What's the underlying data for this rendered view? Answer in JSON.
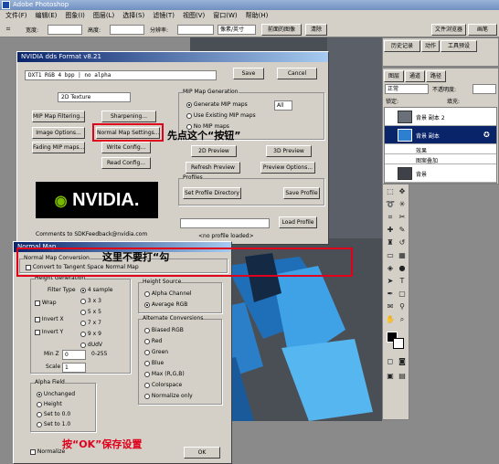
{
  "app": {
    "title": "Adobe Photoshop"
  },
  "menu": [
    "文件(F)",
    "编辑(E)",
    "图象(I)",
    "图层(L)",
    "选择(S)",
    "滤镜(T)",
    "视图(V)",
    "窗口(W)",
    "帮助(H)"
  ],
  "options": {
    "width_label": "宽度:",
    "height_label": "高度:",
    "res_label": "分辨率:",
    "unit": "像素/英寸",
    "front_btn": "前面的图像",
    "clear_btn": "清除",
    "file_browser": "文件浏览器",
    "brush": "画笔"
  },
  "dds": {
    "title": "NVIDIA dds Format v8.21",
    "format_value": "DXT1          RGB    4 bpp | no alpha",
    "save": "Save",
    "cancel": "Cancel",
    "texture_type": "2D Texture",
    "mip_filtering": "MIP Map Filtering...",
    "sharpening": "Sharpening...",
    "image_options": "Image Options...",
    "normal_map_settings": "Normal Map Settings...",
    "fading": "Fading MIP maps...",
    "write_config": "Write Config...",
    "read_config": "Read Config...",
    "mip_group": "MIP Map Generation",
    "mip_gen": "Generate MIP maps",
    "mip_all": "All",
    "mip_existing": "Use Existing MIP maps",
    "mip_none": "No MIP maps",
    "preview_2d": "2D Preview",
    "preview_3d": "3D Preview",
    "refresh": "Refresh Preview",
    "preview_options": "Preview Options...",
    "profiles": "Profiles",
    "set_profile_dir": "Set Profile Directory",
    "save_profile": "Save Profile",
    "load_profile": "Load Profile",
    "logo_text": "NVIDIA.",
    "comments": "Comments to SDKFeedback@nvidia.com",
    "no_profile": "<no profile loaded>"
  },
  "normal": {
    "title": "Normal Map",
    "conversion_group": "Normal Map Conversion",
    "convert_label": "Convert to Tangent Space Normal Map",
    "height_gen": "Height Generation",
    "filter_type": "Filter Type",
    "filters": [
      "4 sample",
      "3 x 3",
      "5 x 5",
      "7 x 7",
      "9 x 9",
      "dUdV"
    ],
    "wrap": "Wrap",
    "invert_x": "Invert X",
    "invert_y": "Invert Y",
    "min_z": "Min Z",
    "min_z_value": "0",
    "range": "0-255",
    "scale": "Scale",
    "scale_value": "1",
    "height_source": "Height Source",
    "alpha_channel": "Alpha Channel",
    "average_rgb": "Average RGB",
    "alt_conv": "Alternate Conversions",
    "alt_options": [
      "Biased RGB",
      "Red",
      "Green",
      "Blue",
      "Max (R,G,B)",
      "Colorspace",
      "Normalize only"
    ],
    "alpha_field": "Alpha Field",
    "alpha_options": [
      "Unchanged",
      "Height",
      "Set to 0.0",
      "Set to 1.0"
    ],
    "normalize": "Normalize",
    "ok": "OK"
  },
  "annotations": {
    "click_button": "先点这个“按钮”",
    "no_check": "这里不要打“勾",
    "ok_save": "按“OK”保存设置"
  },
  "layers_panel": {
    "tabs": [
      "历史记录",
      "动作",
      "工具预设"
    ],
    "tabs2": [
      "图层",
      "通道",
      "路径"
    ],
    "blend": "正常",
    "opacity_label": "不透明度:",
    "lock_label": "锁定:",
    "fill_label": "填充:",
    "layers": [
      "背景 副本 2",
      "背景 副本",
      "效果",
      "图案叠加",
      "背景"
    ]
  },
  "colors": {
    "accent_red": "#e0001c"
  }
}
